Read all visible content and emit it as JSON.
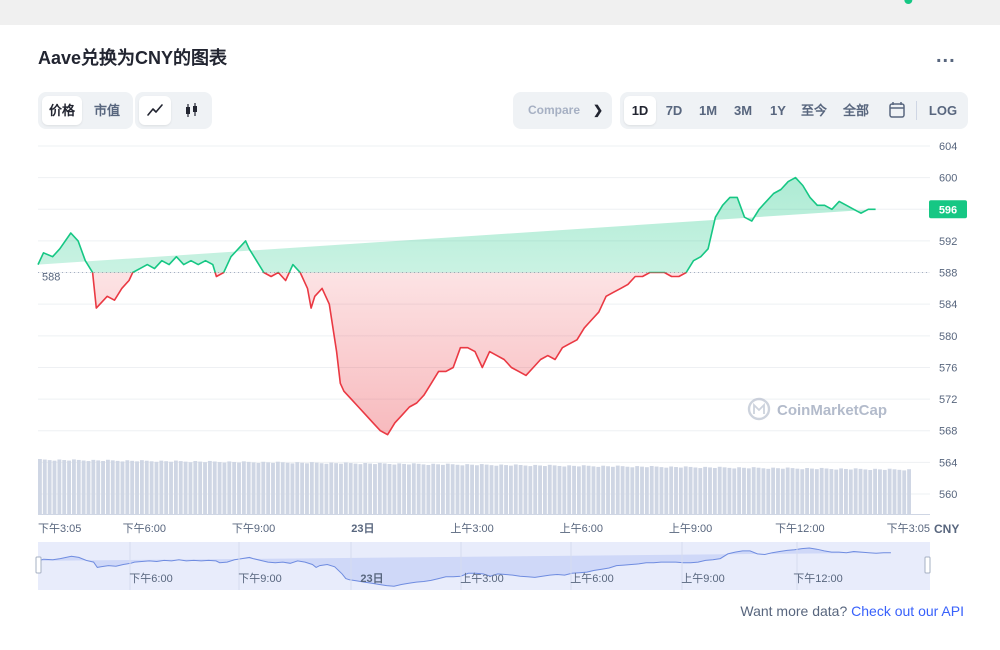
{
  "title": "Aave兑换为CNY的图表",
  "menu_glyph": "...",
  "metric_tabs": [
    "价格",
    "市值"
  ],
  "chart_style_icons": [
    "line-chart-icon",
    "candlestick-icon"
  ],
  "compare_label": "Compare",
  "range_tabs": [
    "1D",
    "7D",
    "1M",
    "3M",
    "1Y",
    "至今",
    "全部"
  ],
  "active_range": "1D",
  "log_label": "LOG",
  "currency_label": "CNY",
  "watermark": "CoinMarketCap",
  "footer": {
    "text": "Want more data? ",
    "link": "Check out our API"
  },
  "colors": {
    "up": "#16c784",
    "down": "#ea3943",
    "accent": "#3861fb"
  },
  "navigator_labels": [
    "下午6:00",
    "下午9:00",
    "23日",
    "上午3:00",
    "上午6:00",
    "上午9:00",
    "下午12:00"
  ],
  "chart_data": {
    "type": "line",
    "ylim": [
      558,
      606
    ],
    "yticks": [
      560,
      564,
      568,
      572,
      576,
      580,
      584,
      588,
      592,
      596,
      600,
      604
    ],
    "x_range_hours": [
      0,
      24
    ],
    "xtick_labels": [
      {
        "h": 0,
        "label": "下午3:05"
      },
      {
        "h": 2.92,
        "label": "下午6:00"
      },
      {
        "h": 5.92,
        "label": "下午9:00"
      },
      {
        "h": 8.92,
        "label": "23日"
      },
      {
        "h": 11.92,
        "label": "上午3:00"
      },
      {
        "h": 14.92,
        "label": "上午6:00"
      },
      {
        "h": 17.92,
        "label": "上午9:00"
      },
      {
        "h": 20.92,
        "label": "下午12:00"
      },
      {
        "h": 23.92,
        "label": "下午3:05"
      }
    ],
    "reference_price": 588,
    "reference_label": "588",
    "last_price_label": "596",
    "series": [
      {
        "hours": [
          0,
          0.15,
          0.4,
          0.6,
          0.9,
          1.1,
          1.3,
          1.5,
          1.6,
          1.7,
          1.9,
          2.1,
          2.3,
          2.5,
          2.6,
          2.8,
          3.0,
          3.2,
          3.4,
          3.6,
          3.8,
          4.0,
          4.2,
          4.4,
          4.6,
          4.8,
          4.9,
          5.1,
          5.3,
          5.5,
          5.7,
          5.8,
          6.0,
          6.2,
          6.4,
          6.6,
          6.8,
          7.0,
          7.2,
          7.4,
          7.5,
          7.6,
          7.8,
          8.0,
          8.2,
          8.3,
          8.4,
          8.6,
          8.8,
          9.0,
          9.2,
          9.4,
          9.6,
          9.8,
          10.0,
          10.2,
          10.4,
          10.6,
          10.8,
          11.0,
          11.2,
          11.4,
          11.6,
          11.8,
          12.0,
          12.2,
          12.4,
          12.6,
          12.8,
          13.0,
          13.2,
          13.4,
          13.6,
          13.8,
          14.0,
          14.2,
          14.4,
          14.6,
          14.8,
          15.0,
          15.2,
          15.4,
          15.6,
          15.8,
          16.0,
          16.2,
          16.4,
          16.6,
          16.8,
          17.0,
          17.2,
          17.4,
          17.6,
          17.8,
          18.0,
          18.2,
          18.4,
          18.6,
          18.8,
          19.0,
          19.2,
          19.4,
          19.6,
          19.8,
          20.0,
          20.2,
          20.4,
          20.6,
          20.8,
          21.0,
          21.2,
          21.4,
          21.6,
          21.8,
          22.0,
          22.2,
          22.4,
          22.6,
          22.8,
          23.0,
          23.2,
          23.4,
          23.6,
          23.9
        ],
        "values": [
          589,
          590.5,
          590,
          591,
          593,
          592,
          589.5,
          588,
          583.5,
          584,
          585,
          584.5,
          586,
          587,
          588,
          588.5,
          589,
          588.5,
          589.5,
          589,
          590,
          589,
          589.5,
          589,
          589.5,
          589,
          587.5,
          588,
          590,
          591,
          592,
          591,
          589.5,
          588,
          587.5,
          588,
          587,
          589,
          588,
          586,
          583.5,
          585,
          586,
          584,
          578,
          574,
          573,
          572,
          571,
          570,
          569,
          568,
          567.5,
          569,
          570,
          571,
          571.5,
          572.5,
          574,
          575.5,
          575.5,
          576,
          578.5,
          578.5,
          578,
          576,
          578,
          577.5,
          577,
          576,
          575.5,
          575,
          576,
          577,
          577.5,
          577,
          578.5,
          579,
          579.5,
          581,
          582,
          583,
          585,
          585.5,
          586,
          586.5,
          587.5,
          587.5,
          588,
          588,
          588,
          587.5,
          587.5,
          588,
          589.5,
          590,
          591,
          595,
          596.5,
          597.5,
          597.5,
          595,
          594.5,
          596,
          597,
          598,
          598.5,
          599.5,
          600,
          599,
          597.5,
          596.5,
          596.5,
          596,
          597,
          596.5,
          596,
          595.5,
          596,
          596
        ]
      }
    ]
  }
}
